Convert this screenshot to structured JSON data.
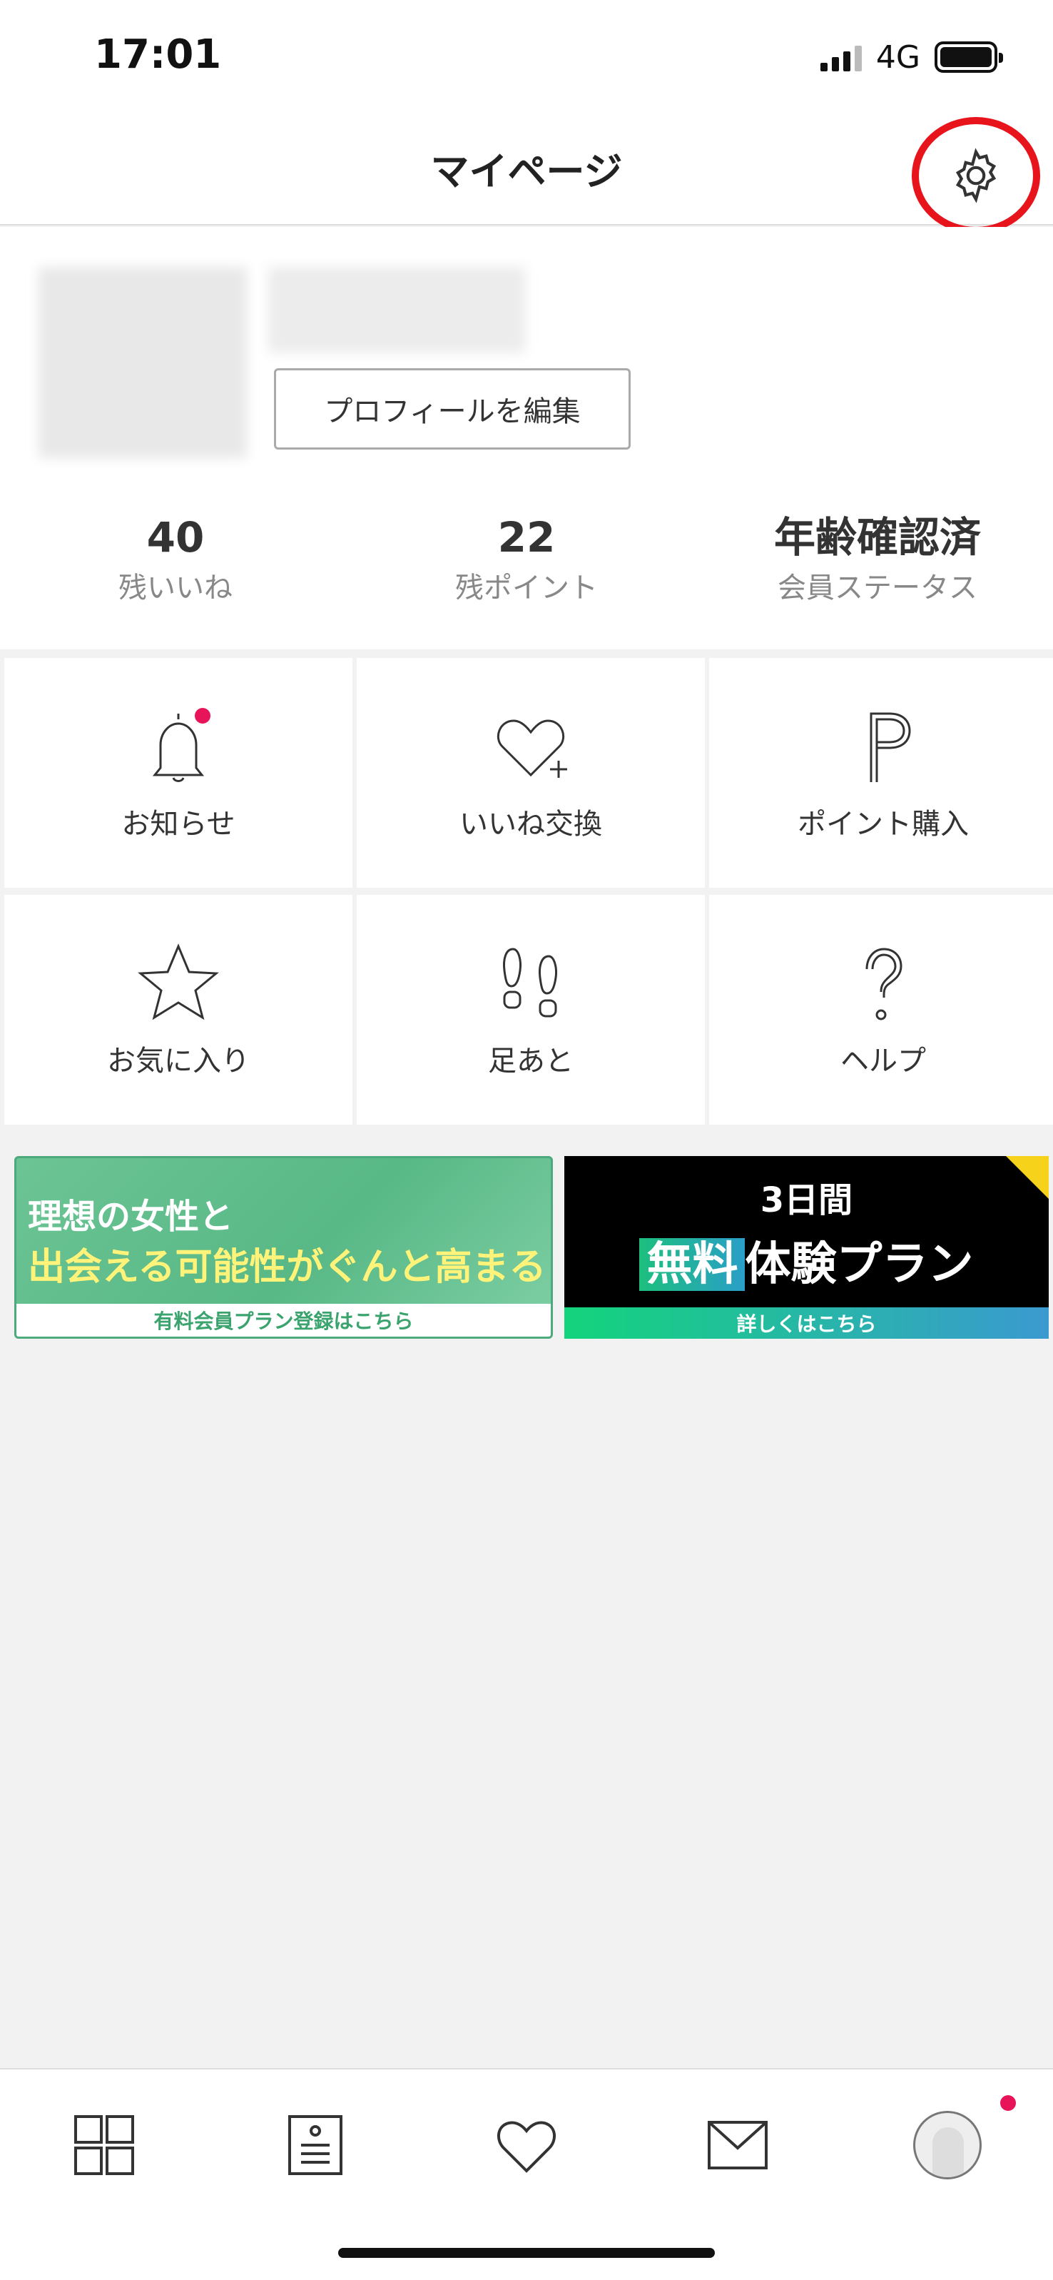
{
  "status_bar": {
    "time": "17:01",
    "network": "4G"
  },
  "header": {
    "title": "マイページ",
    "settings_icon": "gear-icon"
  },
  "profile": {
    "edit_button": "プロフィールを編集",
    "stats": [
      {
        "value": "40",
        "label": "残いいね"
      },
      {
        "value": "22",
        "label": "残ポイント"
      },
      {
        "value": "年齢確認済",
        "label": "会員ステータス"
      }
    ]
  },
  "menu": {
    "items": [
      {
        "label": "お知らせ",
        "icon": "bell-icon"
      },
      {
        "label": "いいね交換",
        "icon": "heart-plus-icon"
      },
      {
        "label": "ポイント購入",
        "icon": "point-p-icon"
      },
      {
        "label": "お気に入り",
        "icon": "star-icon"
      },
      {
        "label": "足あと",
        "icon": "footprints-icon"
      },
      {
        "label": "ヘルプ",
        "icon": "question-icon"
      }
    ]
  },
  "banners": {
    "premium": {
      "line1": "理想の女性と",
      "line2": "出会える可能性がぐんと高まる",
      "footer": "有料会員プラン登録はこちら"
    },
    "trial": {
      "line1": "3日間",
      "highlight": "無料",
      "line2": "体験プラン",
      "footer": "詳しくはこちら"
    }
  },
  "tab_bar": {
    "items": [
      {
        "icon": "grid-icon"
      },
      {
        "icon": "board-icon"
      },
      {
        "icon": "heart-icon"
      },
      {
        "icon": "mail-icon"
      },
      {
        "icon": "avatar-icon"
      }
    ]
  },
  "colors": {
    "accent_red": "#e8141c",
    "notification_dot": "#e8145a",
    "banner_green": "#58b886"
  }
}
